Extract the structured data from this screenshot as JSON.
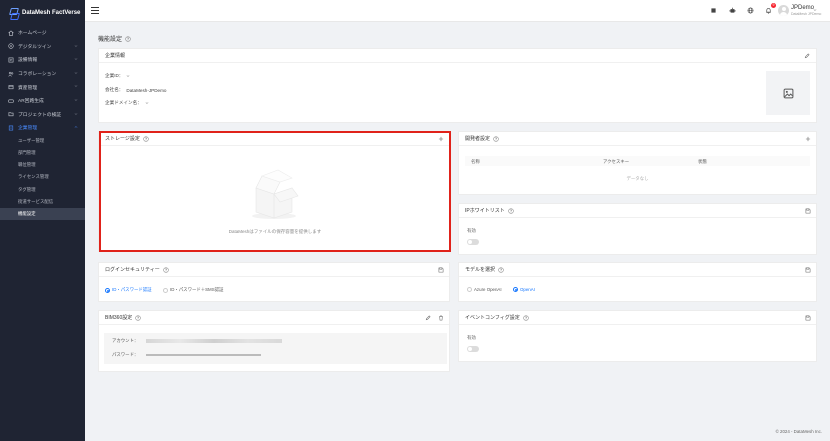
{
  "brand": {
    "name": "DataMesh FactVerse"
  },
  "sidebar": {
    "items": [
      {
        "label": "ホームページ",
        "icon": "home-icon",
        "chevron": false
      },
      {
        "label": "デジタルツイン",
        "icon": "cube-icon",
        "chevron": true
      },
      {
        "label": "設備情報",
        "icon": "device-icon",
        "chevron": true
      },
      {
        "label": "コラボレーション",
        "icon": "team-icon",
        "chevron": true
      },
      {
        "label": "資産管理",
        "icon": "asset-icon",
        "chevron": true
      },
      {
        "label": "AR回路生成",
        "icon": "ar-icon",
        "chevron": true
      },
      {
        "label": "プロジェクトの検証",
        "icon": "project-icon",
        "chevron": true
      },
      {
        "label": "企業管理",
        "icon": "enterprise-icon",
        "chevron": true,
        "active": true
      }
    ],
    "subitems": [
      {
        "label": "ユーザー管理"
      },
      {
        "label": "部門管理"
      },
      {
        "label": "職位管理"
      },
      {
        "label": "ライセンス管理"
      },
      {
        "label": "タグ管理"
      },
      {
        "label": "街道サービス配信"
      },
      {
        "label": "機能設定",
        "selected": true
      }
    ]
  },
  "header": {
    "notification_count": "9",
    "user_name": "JPDemo",
    "user_sub": "DataMesh JPDemo"
  },
  "page": {
    "title": "機能設定"
  },
  "company": {
    "title": "企業情報",
    "id_label": "企業ID：",
    "company_label": "会社名：",
    "company_value": "DataMesh-JPDemo",
    "domain_label": "企業ドメイン名："
  },
  "storage": {
    "title": "ストレージ設定",
    "empty_text": "DataMeshはファイルの保存容量を提供します"
  },
  "developer": {
    "title": "開発者設定",
    "columns": [
      "名称",
      "アクセスキー",
      "状態"
    ],
    "empty_text": "データなし"
  },
  "ip_whitelist": {
    "title": "IPホワイトリスト",
    "enable_label": "有効"
  },
  "login_security": {
    "title": "ログインセキュリティー",
    "options": [
      {
        "label": "ID・パスワード認証",
        "selected": true
      },
      {
        "label": "ID・パスワード＋SMS認証",
        "selected": false
      }
    ]
  },
  "model": {
    "title": "モデルを選択",
    "options": [
      {
        "label": "Azure OpenAI",
        "selected": false
      },
      {
        "label": "OpenAI",
        "selected": true
      }
    ]
  },
  "bim360": {
    "title": "BIM360設定",
    "account_label": "アカウント：",
    "password_label": "パスワード："
  },
  "event": {
    "title": "イベントコンフィグ設定",
    "enable_label": "有効"
  },
  "footer": {
    "copyright": "© 2024 - DataMesh Inc."
  },
  "colors": {
    "accent": "#1677ff",
    "highlight": "#e0221a",
    "sidebar_bg": "#1f2433"
  }
}
